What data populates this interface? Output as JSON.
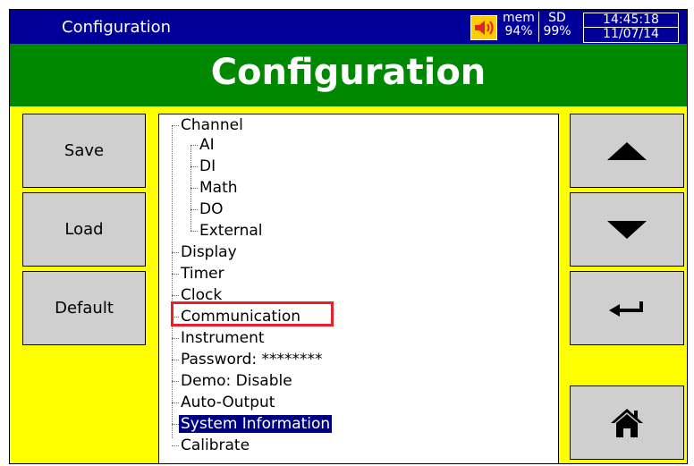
{
  "window": {
    "title": "Configuration"
  },
  "status": {
    "speaker_icon": "speaker-icon",
    "mem_label": "mem",
    "mem_value": "94%",
    "sd_label": "SD",
    "sd_value": "99%",
    "time": "14:45:18",
    "date": "11/07/14"
  },
  "header": {
    "title": "Configuration"
  },
  "left_buttons": [
    "Save",
    "Load",
    "Default"
  ],
  "right_buttons": [
    "up-arrow-icon",
    "down-arrow-icon",
    "enter-icon",
    "home-icon"
  ],
  "tree": {
    "items": [
      "Channel",
      "AI",
      "DI",
      "Math",
      "DO",
      "External",
      "Display",
      "Timer",
      "Clock",
      "Communication",
      "Instrument",
      "Password: ********",
      "Demo: Disable",
      "Auto-Output",
      "System Information",
      "Calibrate"
    ],
    "selected": "System Information",
    "highlighted": "Communication"
  },
  "colors": {
    "title_bar": "#000099",
    "header": "#008800",
    "background": "#ffff00",
    "highlight_box": "#e8202a",
    "selection": "#000080"
  }
}
